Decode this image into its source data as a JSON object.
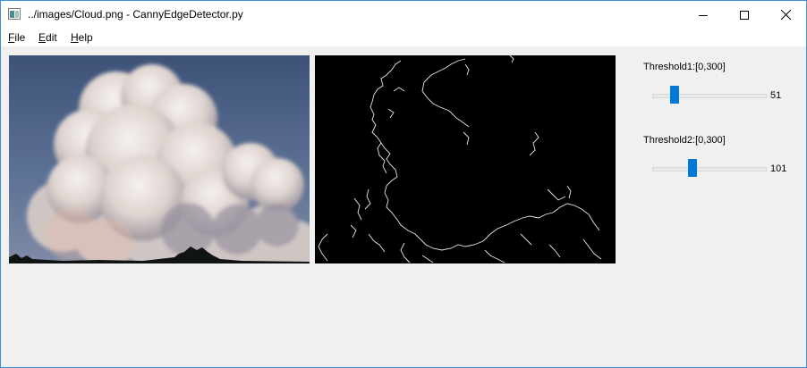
{
  "window": {
    "title": "../images/Cloud.png - CannyEdgeDetector.py",
    "controls": [
      "minimize-icon",
      "maximize-icon",
      "close-icon"
    ]
  },
  "menu": [
    {
      "accel": "F",
      "rest": "ile"
    },
    {
      "accel": "E",
      "rest": "dit"
    },
    {
      "accel": "H",
      "rest": "elp"
    }
  ],
  "images": {
    "original": "cloud-photo",
    "edges": "canny-edge-output"
  },
  "controls": {
    "threshold1": {
      "label": "Threshold1:[0,300]",
      "value": "51",
      "fraction": 0.17
    },
    "threshold2": {
      "label": "Threshold2:[0,300]",
      "value": "101",
      "fraction": 0.337
    }
  },
  "colors": {
    "accent": "#0078d7",
    "window_border": "#3c8fd6",
    "background": "#f0f0f0"
  }
}
